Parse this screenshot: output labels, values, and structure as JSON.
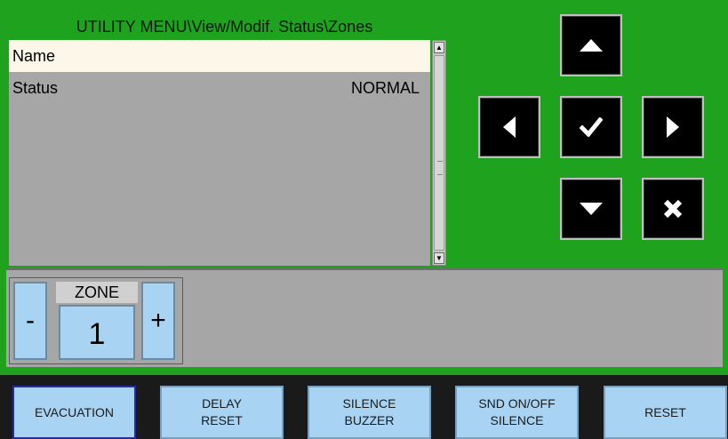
{
  "header": {
    "title": "UTILITY MENU\\View/Modif. Status\\Zones"
  },
  "list": {
    "rows": [
      {
        "label": "Name",
        "value": ""
      },
      {
        "label": "Status",
        "value": "NORMAL"
      }
    ]
  },
  "zone": {
    "label": "ZONE",
    "value": "1",
    "minus": "-",
    "plus": "+"
  },
  "buttons": {
    "evacuation": [
      "EVACUATION"
    ],
    "delay_reset": [
      "DELAY",
      "RESET"
    ],
    "silence_buzzer": [
      "SILENCE",
      "BUZZER"
    ],
    "snd_onoff_silence": [
      "SND ON/OFF",
      "SILENCE"
    ],
    "reset": [
      "RESET"
    ]
  },
  "nav_icons": [
    "arrow-up-icon",
    "arrow-left-icon",
    "check-icon",
    "arrow-right-icon",
    "arrow-down-icon",
    "cancel-x-icon"
  ],
  "colors": {
    "background": "#1fa31f",
    "panel": "#a6a6a6",
    "button": "#a8d3f2",
    "nav": "#000000",
    "selected_row": "#fcf7e8"
  }
}
